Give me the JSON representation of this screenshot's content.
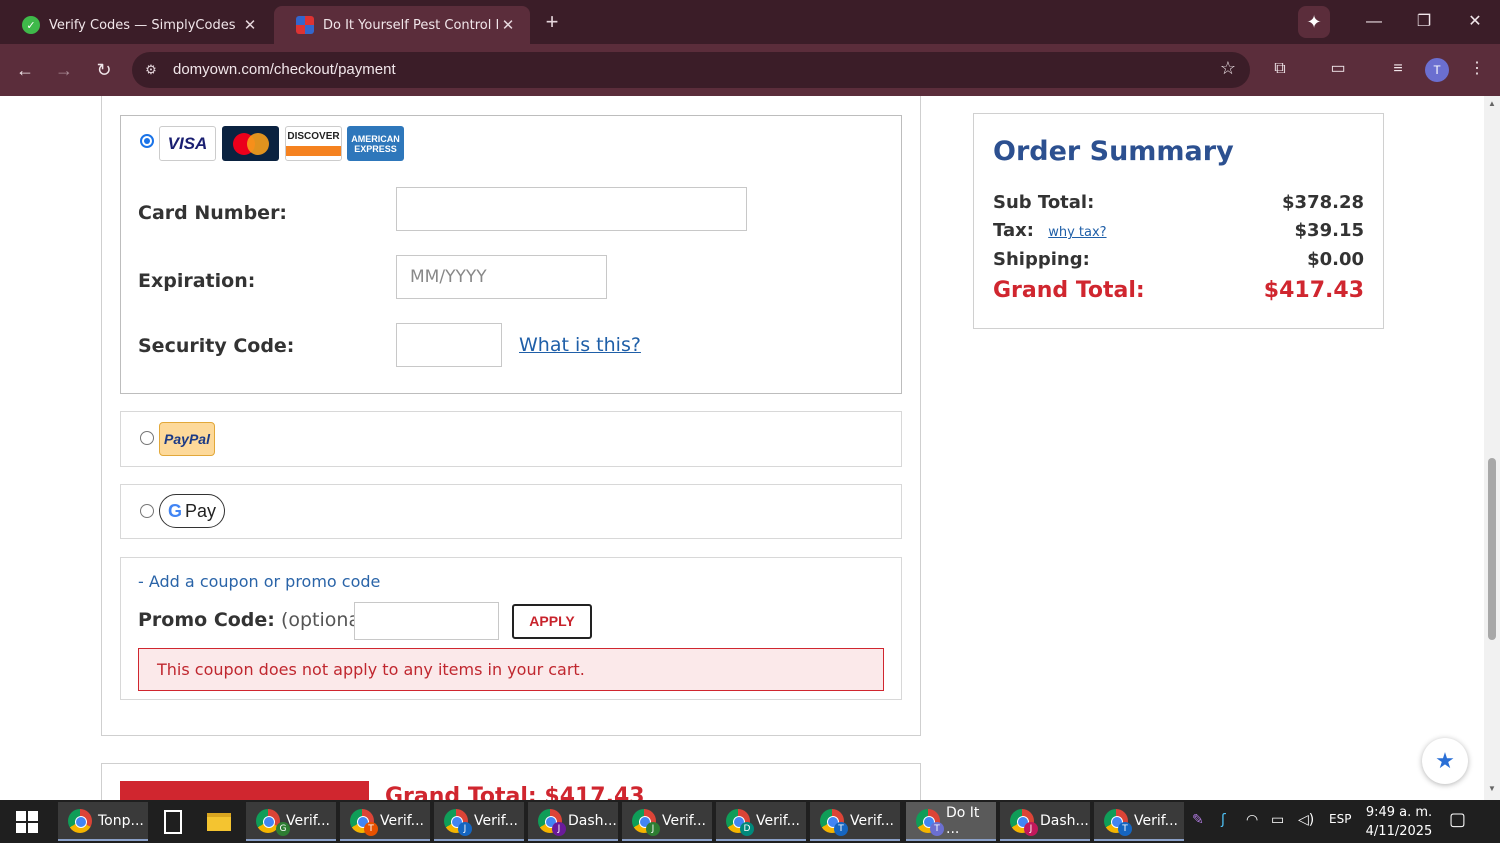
{
  "browser": {
    "tabs": [
      {
        "title": "Verify Codes — SimplyCodes",
        "active": false
      },
      {
        "title": "Do It Yourself Pest Control Prod",
        "active": true
      }
    ],
    "url": "domyown.com/checkout/payment",
    "profile_initial": "T"
  },
  "payment": {
    "card_logos": [
      "VISA",
      "MasterCard",
      "DISCOVER",
      "AMERICAN EXPRESS"
    ],
    "card_number_label": "Card Number:",
    "card_number_value": "",
    "expiration_label": "Expiration:",
    "expiration_placeholder": "MM/YYYY",
    "security_label": "Security Code:",
    "security_help_link": "What is this?",
    "paypal_label": "PayPal",
    "gpay_label": "Pay"
  },
  "promo": {
    "toggle_link": "- Add a coupon or promo code",
    "label": "Promo Code:",
    "label_optional": "(optional)",
    "value": "",
    "apply_button": "APPLY",
    "error_message": "This coupon does not apply to any items in your cart."
  },
  "footer_peek": {
    "grand_total": "Grand Total: $417.43"
  },
  "order_summary": {
    "title": "Order Summary",
    "sub_total_label": "Sub Total:",
    "sub_total_value": "$378.28",
    "tax_label": "Tax:",
    "tax_link": "why tax?",
    "tax_value": "$39.15",
    "shipping_label": "Shipping:",
    "shipping_value": "$0.00",
    "grand_total_label": "Grand Total:",
    "grand_total_value": "$417.43"
  },
  "taskbar": {
    "items": [
      {
        "label": "Tonp...",
        "badge": ""
      },
      {
        "label": "Verif...",
        "badge": "G"
      },
      {
        "label": "Verif...",
        "badge": "T"
      },
      {
        "label": "Verif...",
        "badge": "J"
      },
      {
        "label": "Dash...",
        "badge": "J"
      },
      {
        "label": "Verif...",
        "badge": "J"
      },
      {
        "label": "Verif...",
        "badge": "D"
      },
      {
        "label": "Verif...",
        "badge": "T"
      },
      {
        "label": "Do It ...",
        "badge": "T"
      },
      {
        "label": "Dash...",
        "badge": "J"
      },
      {
        "label": "Verif...",
        "badge": "T"
      }
    ],
    "language": "ESP",
    "time": "9:49 a. m.",
    "date": "4/11/2025"
  }
}
